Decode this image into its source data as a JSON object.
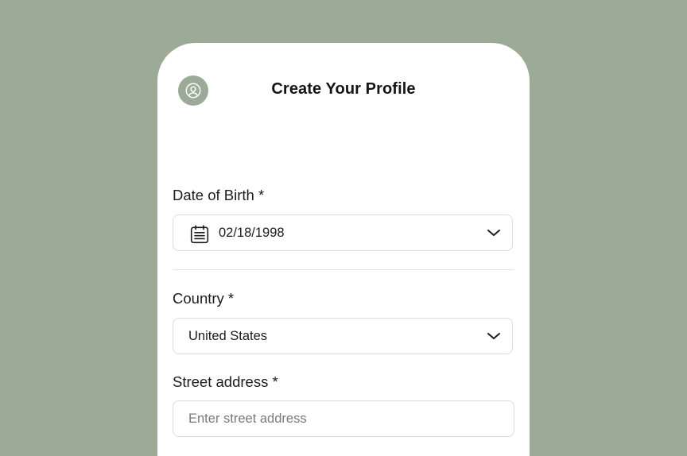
{
  "header": {
    "title": "Create Your Profile",
    "avatar_icon": "user-circle-icon"
  },
  "form": {
    "dob": {
      "label": "Date of Birth *",
      "value": "02/18/1998",
      "icon": "calendar-icon"
    },
    "country": {
      "label": "Country *",
      "value": "United States"
    },
    "street": {
      "label": "Street address *",
      "value": "",
      "placeholder": "Enter street address"
    }
  },
  "colors": {
    "background": "#9caa98",
    "card": "#ffffff",
    "text": "#1c1c1c",
    "border": "#dcdcdc"
  }
}
